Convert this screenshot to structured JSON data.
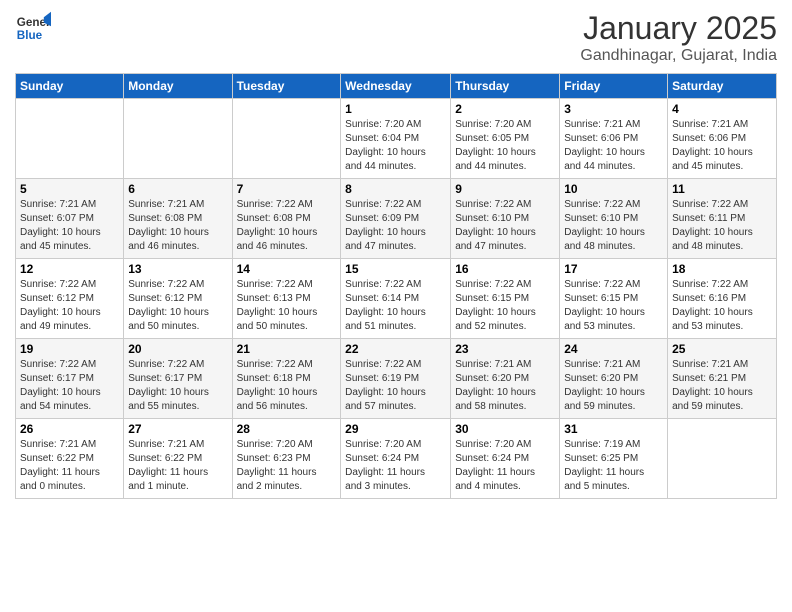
{
  "logo": {
    "line1": "General",
    "line2": "Blue"
  },
  "title": "January 2025",
  "location": "Gandhinagar, Gujarat, India",
  "weekdays": [
    "Sunday",
    "Monday",
    "Tuesday",
    "Wednesday",
    "Thursday",
    "Friday",
    "Saturday"
  ],
  "weeks": [
    [
      {
        "day": "",
        "info": ""
      },
      {
        "day": "",
        "info": ""
      },
      {
        "day": "",
        "info": ""
      },
      {
        "day": "1",
        "info": "Sunrise: 7:20 AM\nSunset: 6:04 PM\nDaylight: 10 hours\nand 44 minutes."
      },
      {
        "day": "2",
        "info": "Sunrise: 7:20 AM\nSunset: 6:05 PM\nDaylight: 10 hours\nand 44 minutes."
      },
      {
        "day": "3",
        "info": "Sunrise: 7:21 AM\nSunset: 6:06 PM\nDaylight: 10 hours\nand 44 minutes."
      },
      {
        "day": "4",
        "info": "Sunrise: 7:21 AM\nSunset: 6:06 PM\nDaylight: 10 hours\nand 45 minutes."
      }
    ],
    [
      {
        "day": "5",
        "info": "Sunrise: 7:21 AM\nSunset: 6:07 PM\nDaylight: 10 hours\nand 45 minutes."
      },
      {
        "day": "6",
        "info": "Sunrise: 7:21 AM\nSunset: 6:08 PM\nDaylight: 10 hours\nand 46 minutes."
      },
      {
        "day": "7",
        "info": "Sunrise: 7:22 AM\nSunset: 6:08 PM\nDaylight: 10 hours\nand 46 minutes."
      },
      {
        "day": "8",
        "info": "Sunrise: 7:22 AM\nSunset: 6:09 PM\nDaylight: 10 hours\nand 47 minutes."
      },
      {
        "day": "9",
        "info": "Sunrise: 7:22 AM\nSunset: 6:10 PM\nDaylight: 10 hours\nand 47 minutes."
      },
      {
        "day": "10",
        "info": "Sunrise: 7:22 AM\nSunset: 6:10 PM\nDaylight: 10 hours\nand 48 minutes."
      },
      {
        "day": "11",
        "info": "Sunrise: 7:22 AM\nSunset: 6:11 PM\nDaylight: 10 hours\nand 48 minutes."
      }
    ],
    [
      {
        "day": "12",
        "info": "Sunrise: 7:22 AM\nSunset: 6:12 PM\nDaylight: 10 hours\nand 49 minutes."
      },
      {
        "day": "13",
        "info": "Sunrise: 7:22 AM\nSunset: 6:12 PM\nDaylight: 10 hours\nand 50 minutes."
      },
      {
        "day": "14",
        "info": "Sunrise: 7:22 AM\nSunset: 6:13 PM\nDaylight: 10 hours\nand 50 minutes."
      },
      {
        "day": "15",
        "info": "Sunrise: 7:22 AM\nSunset: 6:14 PM\nDaylight: 10 hours\nand 51 minutes."
      },
      {
        "day": "16",
        "info": "Sunrise: 7:22 AM\nSunset: 6:15 PM\nDaylight: 10 hours\nand 52 minutes."
      },
      {
        "day": "17",
        "info": "Sunrise: 7:22 AM\nSunset: 6:15 PM\nDaylight: 10 hours\nand 53 minutes."
      },
      {
        "day": "18",
        "info": "Sunrise: 7:22 AM\nSunset: 6:16 PM\nDaylight: 10 hours\nand 53 minutes."
      }
    ],
    [
      {
        "day": "19",
        "info": "Sunrise: 7:22 AM\nSunset: 6:17 PM\nDaylight: 10 hours\nand 54 minutes."
      },
      {
        "day": "20",
        "info": "Sunrise: 7:22 AM\nSunset: 6:17 PM\nDaylight: 10 hours\nand 55 minutes."
      },
      {
        "day": "21",
        "info": "Sunrise: 7:22 AM\nSunset: 6:18 PM\nDaylight: 10 hours\nand 56 minutes."
      },
      {
        "day": "22",
        "info": "Sunrise: 7:22 AM\nSunset: 6:19 PM\nDaylight: 10 hours\nand 57 minutes."
      },
      {
        "day": "23",
        "info": "Sunrise: 7:21 AM\nSunset: 6:20 PM\nDaylight: 10 hours\nand 58 minutes."
      },
      {
        "day": "24",
        "info": "Sunrise: 7:21 AM\nSunset: 6:20 PM\nDaylight: 10 hours\nand 59 minutes."
      },
      {
        "day": "25",
        "info": "Sunrise: 7:21 AM\nSunset: 6:21 PM\nDaylight: 10 hours\nand 59 minutes."
      }
    ],
    [
      {
        "day": "26",
        "info": "Sunrise: 7:21 AM\nSunset: 6:22 PM\nDaylight: 11 hours\nand 0 minutes."
      },
      {
        "day": "27",
        "info": "Sunrise: 7:21 AM\nSunset: 6:22 PM\nDaylight: 11 hours\nand 1 minute."
      },
      {
        "day": "28",
        "info": "Sunrise: 7:20 AM\nSunset: 6:23 PM\nDaylight: 11 hours\nand 2 minutes."
      },
      {
        "day": "29",
        "info": "Sunrise: 7:20 AM\nSunset: 6:24 PM\nDaylight: 11 hours\nand 3 minutes."
      },
      {
        "day": "30",
        "info": "Sunrise: 7:20 AM\nSunset: 6:24 PM\nDaylight: 11 hours\nand 4 minutes."
      },
      {
        "day": "31",
        "info": "Sunrise: 7:19 AM\nSunset: 6:25 PM\nDaylight: 11 hours\nand 5 minutes."
      },
      {
        "day": "",
        "info": ""
      }
    ]
  ]
}
